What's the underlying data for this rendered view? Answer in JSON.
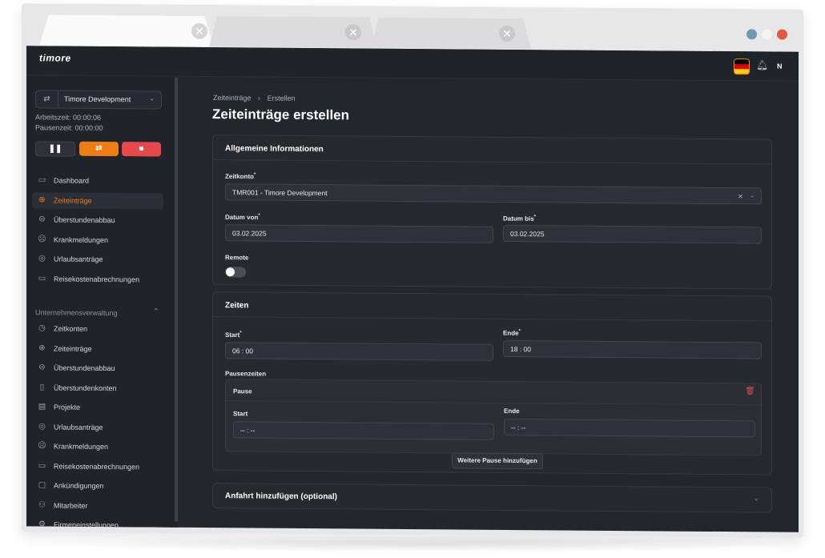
{
  "browser": {
    "tabs": [
      {
        "close": "✕"
      },
      {
        "close": "✕"
      },
      {
        "close": "✕"
      }
    ],
    "window_dots": [
      "#6c9ab3",
      "#f4f4f4",
      "#e5573b"
    ]
  },
  "app": {
    "logo": "timore",
    "user_initial": "N"
  },
  "sidebar": {
    "workspace": "Timore Development",
    "arbeitszeit": "Arbeitszeit: 00:00:06",
    "pausenzeit": "Pausenzeit: 00:00:00",
    "primary_items": [
      {
        "label": "Dashboard",
        "icon": "dashboard-icon",
        "glyph": "▭"
      },
      {
        "label": "Zeiteinträge",
        "icon": "plus-circle-icon",
        "glyph": "⊕"
      },
      {
        "label": "Überstundenabbau",
        "icon": "minus-circle-icon",
        "glyph": "⊖"
      },
      {
        "label": "Krankmeldungen",
        "icon": "sad-face-icon",
        "glyph": "☹"
      },
      {
        "label": "Urlaubsanträge",
        "icon": "globe-icon",
        "glyph": "◎"
      },
      {
        "label": "Reisekostenabrechnungen",
        "icon": "card-icon",
        "glyph": "▭"
      }
    ],
    "section_title": "Unternehmensverwaltung",
    "admin_items": [
      {
        "label": "Zeitkonten",
        "icon": "clock-icon",
        "glyph": "◷"
      },
      {
        "label": "Zeiteinträge",
        "icon": "plus-circle-icon",
        "glyph": "⊕"
      },
      {
        "label": "Überstundenabbau",
        "icon": "minus-circle-icon",
        "glyph": "⊖"
      },
      {
        "label": "Überstundenkonten",
        "icon": "clipboard-icon",
        "glyph": "▯"
      },
      {
        "label": "Projekte",
        "icon": "project-icon",
        "glyph": "▤"
      },
      {
        "label": "Urlaubsanträge",
        "icon": "globe-icon",
        "glyph": "◎"
      },
      {
        "label": "Krankmeldungen",
        "icon": "sad-face-icon",
        "glyph": "☹"
      },
      {
        "label": "Reisekostenabrechnungen",
        "icon": "card-icon",
        "glyph": "▭"
      },
      {
        "label": "Ankündigungen",
        "icon": "chat-icon",
        "glyph": "▢"
      },
      {
        "label": "Mitarbeiter",
        "icon": "users-icon",
        "glyph": "⚇"
      },
      {
        "label": "Firmeneinstellungen",
        "icon": "settings-icon",
        "glyph": "⚙"
      }
    ]
  },
  "main": {
    "breadcrumb": [
      "Zeiteinträge",
      "›",
      "Erstellen"
    ],
    "title": "Zeiteinträge erstellen",
    "general": {
      "title": "Allgemeine Informationen",
      "zeitkonto_label": "Zeitkonto",
      "zeitkonto_value": "TMR001 - Timore Development",
      "datum_von_label": "Datum von",
      "datum_von_value": "03.02.2025",
      "datum_bis_label": "Datum bis",
      "datum_bis_value": "03.02.2025",
      "remote_label": "Remote",
      "remote_on": false
    },
    "zeiten": {
      "title": "Zeiten",
      "start_label": "Start",
      "start_value": "06 : 00",
      "ende_label": "Ende",
      "ende_value": "18 : 00",
      "pausen_label": "Pausenzeiten",
      "pause_title": "Pause",
      "pause_start_label": "Start",
      "pause_start_value": "-- : --",
      "pause_ende_label": "Ende",
      "pause_ende_value": "-- : --",
      "add_pause": "Weitere Pause hinzufügen"
    },
    "anfahrt": {
      "title": "Anfahrt hinzufügen (optional)"
    }
  }
}
